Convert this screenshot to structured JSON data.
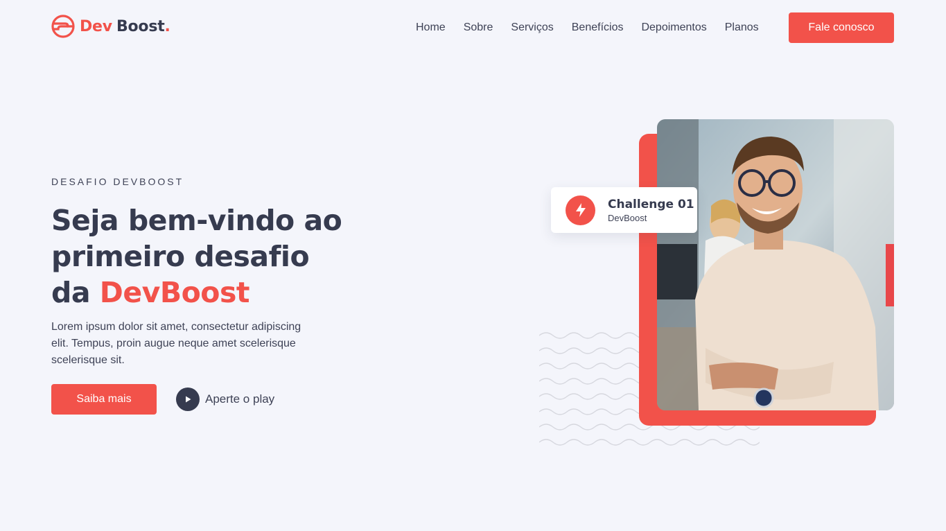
{
  "brand": {
    "name_part1": "Dev",
    "name_part2": "Boost",
    "name_dot": ".",
    "accent_color": "#f2524a",
    "dark_color": "#363b4f"
  },
  "nav": {
    "items": [
      "Home",
      "Sobre",
      "Serviços",
      "Benefícios",
      "Depoimentos",
      "Planos"
    ],
    "cta_label": "Fale conosco"
  },
  "hero": {
    "eyebrow": "DESAFIO DEVBOOST",
    "title_line1": "Seja bem-vindo ao",
    "title_line2": "primeiro desafio",
    "title_line3_prefix": "da ",
    "title_line3_accent": "DevBoost",
    "description": "Lorem ipsum dolor sit amet, consectetur adipiscing elit. Tempus, proin augue neque amet scelerisque scelerisque sit.",
    "primary_button": "Saiba mais",
    "play_label": "Aperte o play"
  },
  "badge": {
    "title": "Challenge 01",
    "subtitle": "DevBoost",
    "icon": "lightning-icon"
  },
  "icons": {
    "logo": "devboost-logo-icon",
    "play": "play-icon",
    "photo": "smiling-man-photo"
  }
}
